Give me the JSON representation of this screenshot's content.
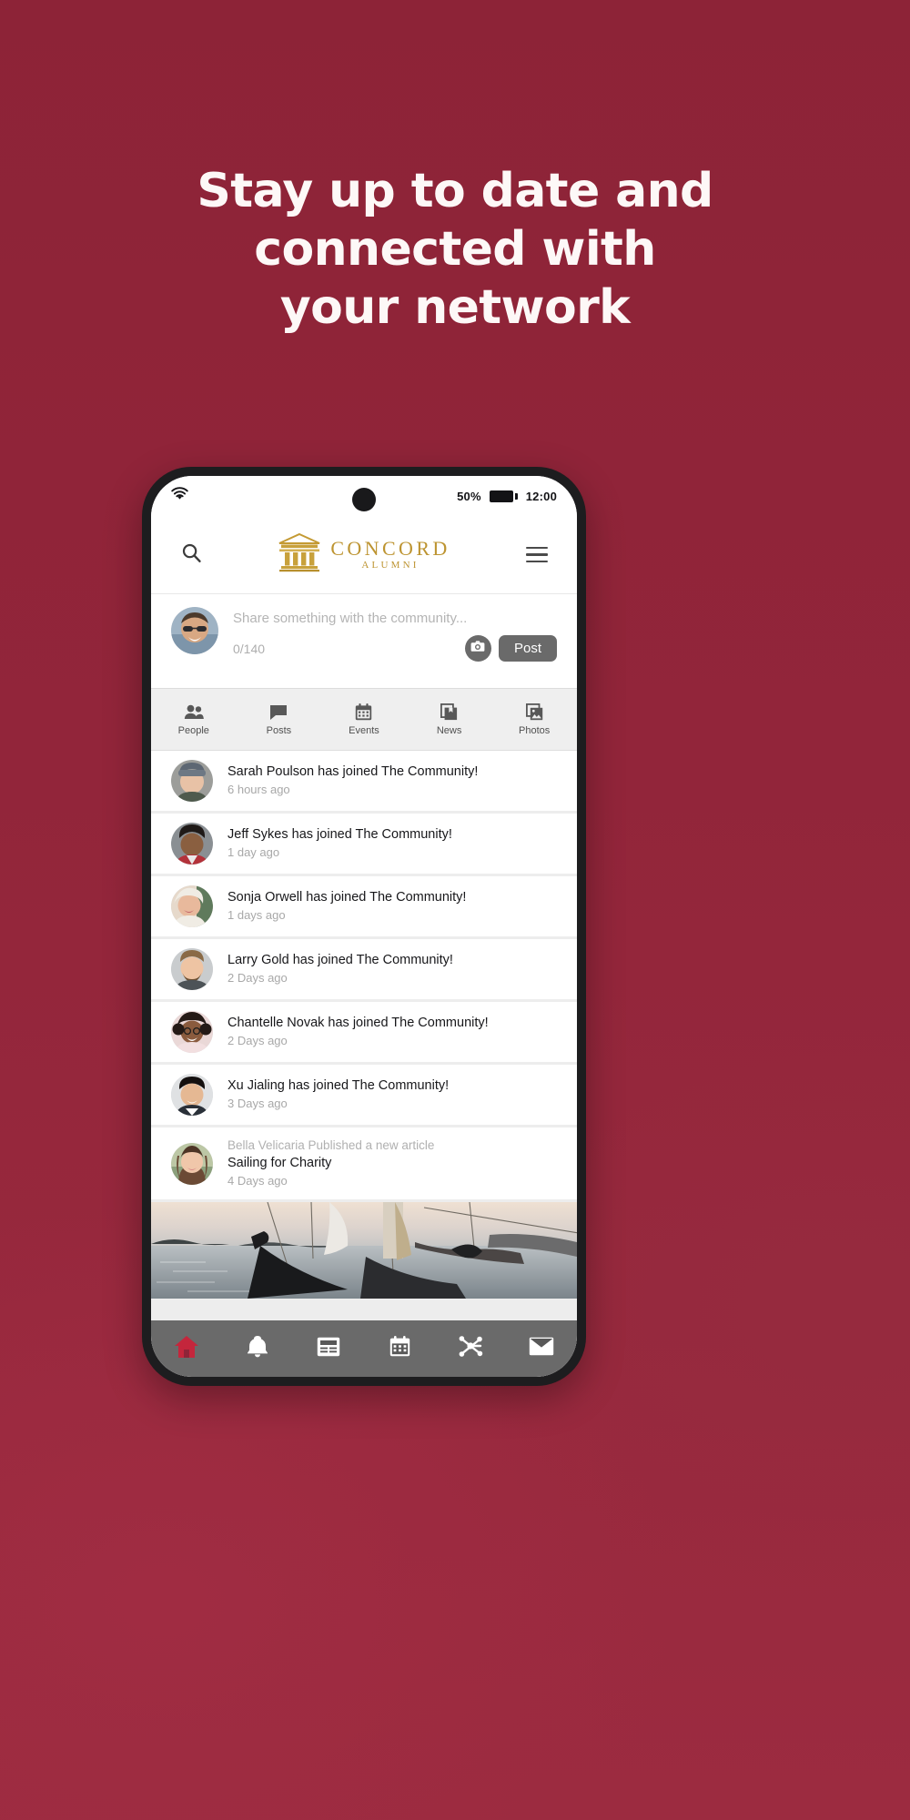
{
  "promo": {
    "background_color": "#8e2438",
    "headline_lines": [
      "Stay up to date and",
      "connected with",
      "your network"
    ],
    "headline_color": "#fdf8f7"
  },
  "phone": {
    "status_bar": {
      "wifi_icon": "wifi-icon",
      "battery_percent": "50%",
      "battery_icon": "battery-icon",
      "time": "12:00"
    },
    "header": {
      "search_icon": "search-icon",
      "logo_icon": "classical-building-icon",
      "logo_primary": "CONCORD",
      "logo_secondary": "ALUMNI",
      "logo_color": "#bd9431",
      "menu_icon": "hamburger-menu-icon"
    },
    "composer": {
      "avatar": "user-avatar",
      "placeholder": "Share something with the community...",
      "char_count": "0/140",
      "camera_icon": "camera-icon",
      "post_label": "Post",
      "post_color": "#6a6a6a"
    },
    "tabs": [
      {
        "label": "People",
        "icon": "people-icon"
      },
      {
        "label": "Posts",
        "icon": "speech-bubble-icon"
      },
      {
        "label": "Events",
        "icon": "calendar-icon"
      },
      {
        "label": "News",
        "icon": "book-icon"
      },
      {
        "label": "Photos",
        "icon": "photos-icon"
      }
    ],
    "feed": [
      {
        "title": "Sarah Poulson has joined The Community!",
        "time": "6 hours ago"
      },
      {
        "title": "Jeff Sykes has joined The Community!",
        "time": "1 day ago"
      },
      {
        "title": "Sonja Orwell has joined The Community!",
        "time": "1 days ago"
      },
      {
        "title": "Larry Gold has joined The Community!",
        "time": "2 Days ago"
      },
      {
        "title": "Chantelle Novak has joined The Community!",
        "time": "2 Days ago"
      },
      {
        "title": "Xu Jialing has joined The Community!",
        "time": "3 Days ago"
      }
    ],
    "article": {
      "byline": "Bella Velicaria Published a new article",
      "title": "Sailing for Charity",
      "time": "4 Days ago",
      "photo_alt": "sailboat-photo"
    },
    "bottom_nav": [
      {
        "icon": "home-icon",
        "active": true,
        "active_color": "#c4263c"
      },
      {
        "icon": "bell-icon",
        "active": false
      },
      {
        "icon": "news-feed-icon",
        "active": false
      },
      {
        "icon": "calendar-icon",
        "active": false
      },
      {
        "icon": "network-icon",
        "active": false
      },
      {
        "icon": "envelope-icon",
        "active": false
      }
    ]
  }
}
